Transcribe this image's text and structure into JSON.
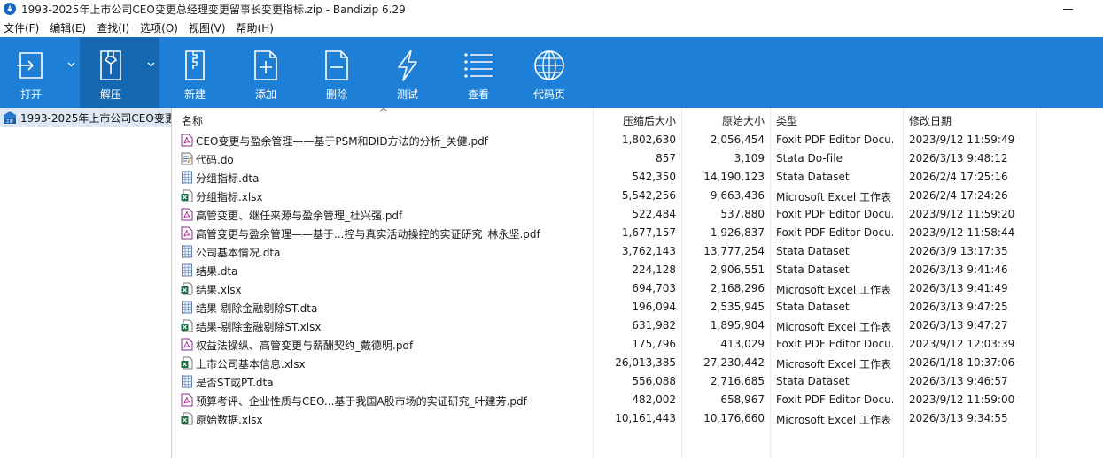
{
  "window": {
    "title": "1993-2025年上市公司CEO变更总经理变更留事长变更指标.zip - Bandizip 6.29"
  },
  "menu": [
    "文件(F)",
    "编辑(E)",
    "查找(I)",
    "选项(O)",
    "视图(V)",
    "帮助(H)"
  ],
  "toolbar": {
    "open": "打开",
    "extract": "解压",
    "new": "新建",
    "add": "添加",
    "delete": "删除",
    "test": "测试",
    "view": "查看",
    "codepage": "代码页"
  },
  "colors": {
    "toolbar_bg": "#1e7fd6",
    "toolbar_active": "#1667b2",
    "tree_selected": "#dde8f4"
  },
  "tree": {
    "root_label": "1993-2025年上市公司CEO变更"
  },
  "columns": {
    "name": "名称",
    "compressed": "压缩后大小",
    "original": "原始大小",
    "type": "类型",
    "modified": "修改日期"
  },
  "files": [
    {
      "icon": "pdf-icon",
      "name": "CEO变更与盈余管理——基于PSM和DID方法的分析_关健.pdf",
      "compressed": "1,802,630",
      "original": "2,056,454",
      "type": "Foxit PDF Editor Docu...",
      "modified": "2023/9/12 11:59:49"
    },
    {
      "icon": "do-file-icon",
      "name": "代码.do",
      "compressed": "857",
      "original": "3,109",
      "type": "Stata Do-file",
      "modified": "2026/3/13 9:48:12"
    },
    {
      "icon": "dta-icon",
      "name": "分组指标.dta",
      "compressed": "542,350",
      "original": "14,190,123",
      "type": "Stata Dataset",
      "modified": "2026/2/4 17:25:16"
    },
    {
      "icon": "excel-icon",
      "name": "分组指标.xlsx",
      "compressed": "5,542,256",
      "original": "9,663,436",
      "type": "Microsoft Excel 工作表",
      "modified": "2026/2/4 17:24:26"
    },
    {
      "icon": "pdf-icon",
      "name": "高管变更、继任来源与盈余管理_杜兴强.pdf",
      "compressed": "522,484",
      "original": "537,880",
      "type": "Foxit PDF Editor Docu...",
      "modified": "2023/9/12 11:59:20"
    },
    {
      "icon": "pdf-icon",
      "name": "高管变更与盈余管理——基于...控与真实活动操控的实证研究_林永坚.pdf",
      "compressed": "1,677,157",
      "original": "1,926,837",
      "type": "Foxit PDF Editor Docu...",
      "modified": "2023/9/12 11:58:44"
    },
    {
      "icon": "dta-icon",
      "name": "公司基本情况.dta",
      "compressed": "3,762,143",
      "original": "13,777,254",
      "type": "Stata Dataset",
      "modified": "2026/3/9 13:17:35"
    },
    {
      "icon": "dta-icon",
      "name": "结果.dta",
      "compressed": "224,128",
      "original": "2,906,551",
      "type": "Stata Dataset",
      "modified": "2026/3/13 9:41:46"
    },
    {
      "icon": "excel-icon",
      "name": "结果.xlsx",
      "compressed": "694,703",
      "original": "2,168,296",
      "type": "Microsoft Excel 工作表",
      "modified": "2026/3/13 9:41:49"
    },
    {
      "icon": "dta-icon",
      "name": "结果-剔除金融剔除ST.dta",
      "compressed": "196,094",
      "original": "2,535,945",
      "type": "Stata Dataset",
      "modified": "2026/3/13 9:47:25"
    },
    {
      "icon": "excel-icon",
      "name": "结果-剔除金融剔除ST.xlsx",
      "compressed": "631,982",
      "original": "1,895,904",
      "type": "Microsoft Excel 工作表",
      "modified": "2026/3/13 9:47:27"
    },
    {
      "icon": "pdf-icon",
      "name": "权益法操纵、高管变更与薪酬契约_戴德明.pdf",
      "compressed": "175,796",
      "original": "413,029",
      "type": "Foxit PDF Editor Docu...",
      "modified": "2023/9/12 12:03:39"
    },
    {
      "icon": "excel-icon",
      "name": "上市公司基本信息.xlsx",
      "compressed": "26,013,385",
      "original": "27,230,442",
      "type": "Microsoft Excel 工作表",
      "modified": "2026/1/18 10:37:06"
    },
    {
      "icon": "dta-icon",
      "name": "是否ST或PT.dta",
      "compressed": "556,088",
      "original": "2,716,685",
      "type": "Stata Dataset",
      "modified": "2026/3/13 9:46:57"
    },
    {
      "icon": "pdf-icon",
      "name": "预算考评、企业性质与CEO...基于我国A股市场的实证研究_叶建芳.pdf",
      "compressed": "482,002",
      "original": "658,967",
      "type": "Foxit PDF Editor Docu...",
      "modified": "2023/9/12 11:59:00"
    },
    {
      "icon": "excel-icon",
      "name": "原始数据.xlsx",
      "compressed": "10,161,443",
      "original": "10,176,660",
      "type": "Microsoft Excel 工作表",
      "modified": "2026/3/13 9:34:55"
    }
  ]
}
